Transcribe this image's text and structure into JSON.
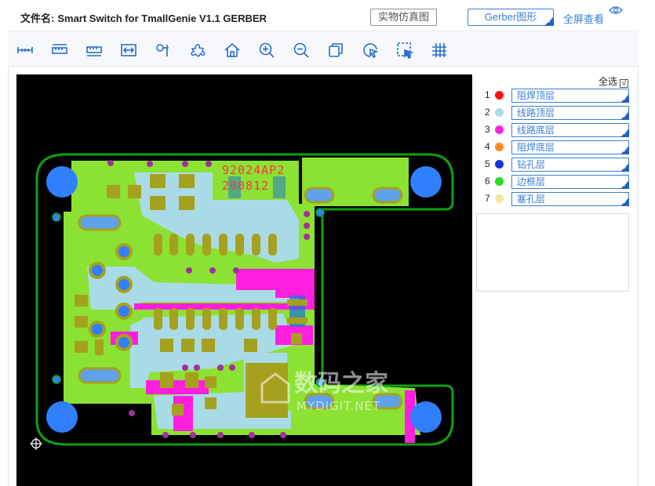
{
  "header": {
    "file_label": "文件名:",
    "file_name": "Smart Switch for TmallGenie V1.1 GERBER",
    "sim_button": "实物仿真图",
    "gerber_button": "Gerber图形",
    "fullscreen": "全屏查看"
  },
  "toolbar": {
    "tools": [
      "ruler-icon",
      "ruler-icon",
      "ruler-icon",
      "fit-width-icon",
      "probe-icon",
      "puzzle-icon",
      "home-icon",
      "zoom-in-icon",
      "zoom-out-icon",
      "copy-icon",
      "pointer-icon",
      "select-area-icon",
      "grid-icon"
    ]
  },
  "board": {
    "silkscreen_line1": "92024AP2",
    "silkscreen_line2": "200812",
    "watermark_cn": "数码之家",
    "watermark_en": "MYDIGIT.NET"
  },
  "layers": {
    "select_all": "全选",
    "select_all_checked": "√",
    "items": [
      {
        "num": "1",
        "label": "阻焊顶层",
        "color": "#ff1111"
      },
      {
        "num": "2",
        "label": "线路顶层",
        "color": "#a8dcea"
      },
      {
        "num": "3",
        "label": "线路底层",
        "color": "#ff22dd"
      },
      {
        "num": "4",
        "label": "阻焊底层",
        "color": "#ff8a22"
      },
      {
        "num": "5",
        "label": "钻孔层",
        "color": "#1133dd"
      },
      {
        "num": "6",
        "label": "边框层",
        "color": "#22dd22"
      },
      {
        "num": "7",
        "label": "塞孔层",
        "color": "#f2e7a0"
      }
    ]
  },
  "colors": {
    "accent": "#3a7fd0",
    "board_green": "#88e233",
    "copper_olive": "#a5a01e",
    "outline": "#13a313",
    "drill_blue": "#2f7fff"
  }
}
